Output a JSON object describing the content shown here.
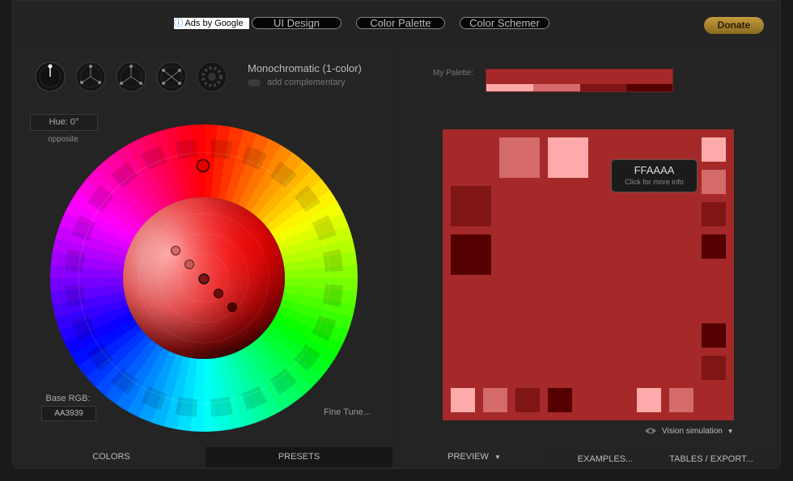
{
  "nav": {
    "ads_label": "Ads by Google",
    "ads_icon": "info-icon",
    "links": [
      "UI Design",
      "Color Palette",
      "Color Schemer"
    ],
    "donate": "Donate"
  },
  "scheme": {
    "title": "Monochromatic (1-color)",
    "add_complementary": "add complementary",
    "hue": "Hue: 0°",
    "opposite": "opposite",
    "base_rgb_label": "Base RGB:",
    "base_rgb": "AA3939",
    "fine_tune": "Fine Tune..."
  },
  "tabs": {
    "left": [
      "COLORS",
      "PRESETS"
    ],
    "right": [
      "PREVIEW",
      "EXAMPLES...",
      "TABLES / EXPORT..."
    ]
  },
  "palette": {
    "label": "My Palette:",
    "base": "#a52929",
    "swatches": [
      "#ffaaaa",
      "#d46a6a",
      "#801515",
      "#550000"
    ]
  },
  "tooltip": {
    "hex": "FFAAAA",
    "hint": "Click for more info"
  },
  "vision": {
    "label": "Vision simulation",
    "icon": "eye-icon"
  },
  "colors": {
    "accent": "#c49b3c",
    "background": "#1a1a1a"
  }
}
